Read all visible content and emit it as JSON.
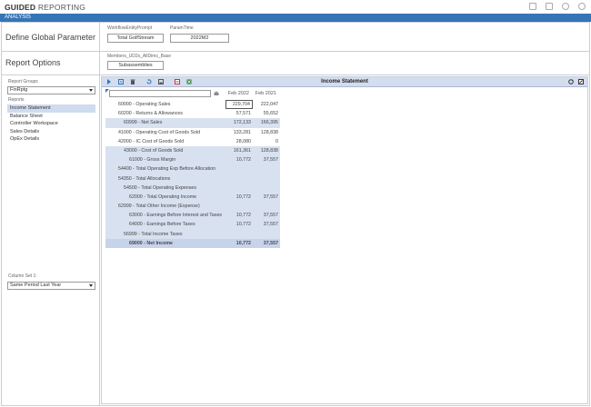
{
  "header": {
    "title_bold": "GUIDED",
    "title_light": "REPORTING"
  },
  "tab": {
    "label": "ANALYSIS"
  },
  "left": {
    "define_global": "Define Global Parameter",
    "report_options": "Report Options",
    "report_groups_label": "Report Groups",
    "report_group_value": "FinRptg",
    "reports_label": "Reports",
    "reports": [
      {
        "label": "Income Statement",
        "active": true
      },
      {
        "label": "Balance Sheet",
        "active": false
      },
      {
        "label": "Controller Workspace",
        "active": false
      },
      {
        "label": "Sales Details",
        "active": false
      },
      {
        "label": "OpEx Details",
        "active": false
      }
    ],
    "column_set_label": "Column Set 1:",
    "column_set_value": "Same Period Last Year"
  },
  "params": {
    "workflow_label": "WorkflowEntityPrompt",
    "workflow_value": "Total GolfStream",
    "paramtime_label": "ParamTime",
    "paramtime_value": "2022M2",
    "members_label": "Members_UD2s_AllDims_Base",
    "members_value": "Subassemblies"
  },
  "report": {
    "title": "Income Statement",
    "columns": [
      "Feb 2022",
      "Feb 2021"
    ],
    "rows": [
      {
        "label": "60000 - Operating Sales",
        "indent": 2,
        "v1": "229,704",
        "v2": "222,047",
        "style": "normal",
        "boxed": true
      },
      {
        "label": "60200 - Returns & Allowances",
        "indent": 2,
        "v1": "57,571",
        "v2": "55,652",
        "style": "normal"
      },
      {
        "label": "60999 - Net Sales",
        "indent": 4,
        "v1": "172,133",
        "v2": "166,395",
        "style": "shaded"
      },
      {
        "label": "41000 - Operating Cost of Goods Sold",
        "indent": 2,
        "v1": "133,281",
        "v2": "128,838",
        "style": "normal"
      },
      {
        "label": "42000 - IC Cost of Goods Sold",
        "indent": 2,
        "v1": "28,080",
        "v2": "0",
        "style": "normal"
      },
      {
        "label": "43000 - Cost of Goods Sold",
        "indent": 4,
        "v1": "161,361",
        "v2": "128,838",
        "style": "shaded"
      },
      {
        "label": "61000 - Gross Margin",
        "indent": 6,
        "v1": "10,772",
        "v2": "37,557",
        "style": "shaded"
      },
      {
        "label": "54400 - Total Operating Exp Before Allocation",
        "indent": 2,
        "v1": "",
        "v2": "",
        "style": "shaded"
      },
      {
        "label": "54350 - Total Allocations",
        "indent": 2,
        "v1": "",
        "v2": "",
        "style": "shaded"
      },
      {
        "label": "54500 - Total Operating Expenses",
        "indent": 4,
        "v1": "",
        "v2": "",
        "style": "shaded"
      },
      {
        "label": "62000 - Total Operating Income",
        "indent": 6,
        "v1": "10,772",
        "v2": "37,557",
        "style": "shaded"
      },
      {
        "label": "62999 - Total Other Income (Expense)",
        "indent": 2,
        "v1": "",
        "v2": "",
        "style": "shaded"
      },
      {
        "label": "63000 - Earnings Before Interest and Taxes",
        "indent": 6,
        "v1": "10,772",
        "v2": "37,557",
        "style": "shaded"
      },
      {
        "label": "64000 - Earnings Before Taxes",
        "indent": 6,
        "v1": "10,772",
        "v2": "37,557",
        "style": "shaded"
      },
      {
        "label": "56999 - Total Income Taxes",
        "indent": 4,
        "v1": "",
        "v2": "",
        "style": "shaded"
      },
      {
        "label": "69000 - Net Income",
        "indent": 6,
        "v1": "10,772",
        "v2": "37,557",
        "style": "final"
      }
    ]
  },
  "colors": {
    "accent": "#3574b7",
    "toolbar": "#d3ddef",
    "row_shade": "#d8e1f0",
    "selected": "#cfdcef"
  },
  "icons": {
    "toolbar": [
      "play-icon",
      "export-icon",
      "delete-icon",
      "undo-icon",
      "save-icon",
      "pdf-icon",
      "excel-icon",
      "refresh-icon",
      "settings-icon"
    ],
    "header": [
      "notification-icon",
      "document-icon",
      "gear-icon",
      "help-icon"
    ]
  }
}
